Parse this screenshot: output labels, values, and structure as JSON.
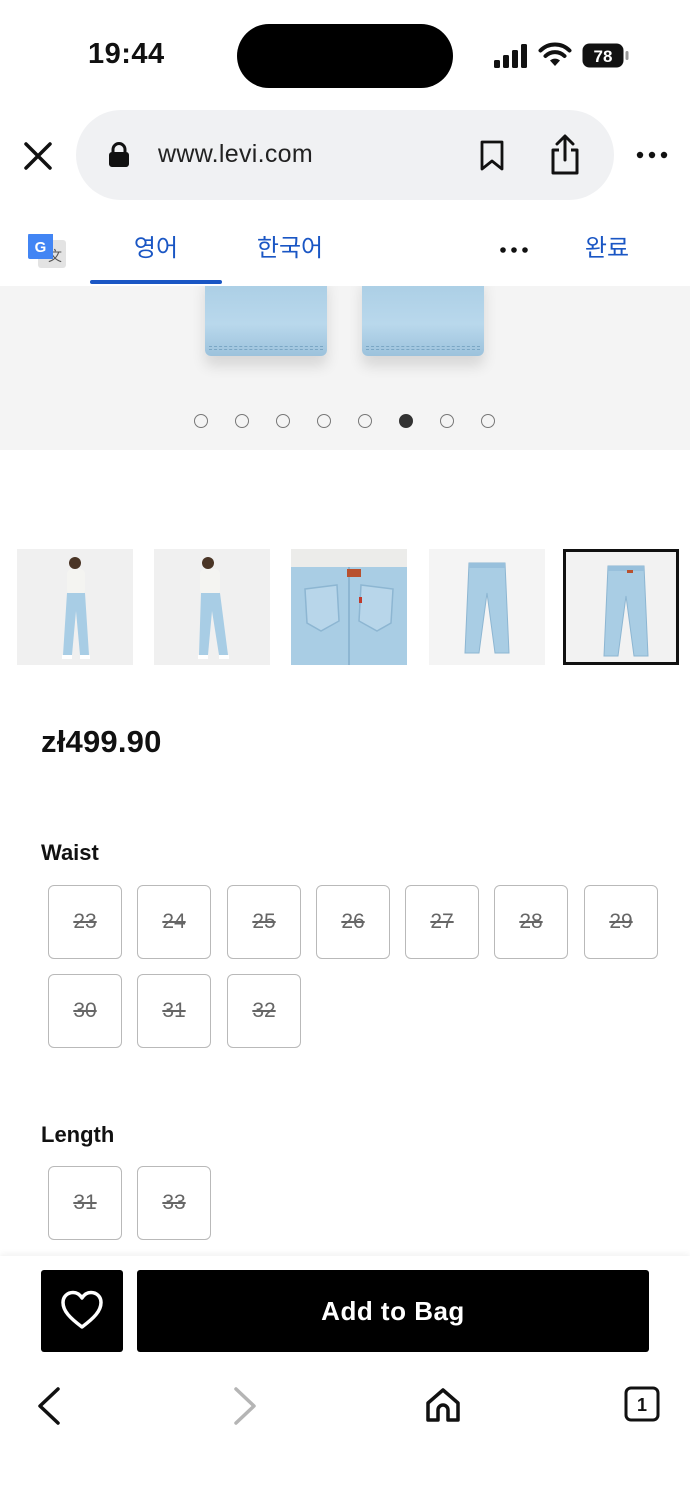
{
  "status_bar": {
    "time": "19:44",
    "battery": "78"
  },
  "browser": {
    "url": "www.levi.com"
  },
  "translate_bar": {
    "tab_source": "영어",
    "tab_target": "한국어",
    "done_label": "완료",
    "google_glyph": "G",
    "translate_glyph": "文"
  },
  "gallery": {
    "total_images": 8,
    "active_index": 5,
    "thumbnails": [
      "model-front",
      "model-back",
      "back-pocket-closeup",
      "jeans-front",
      "jeans-back"
    ],
    "selected_thumbnail": 4
  },
  "product": {
    "price": "zł499.90"
  },
  "waist": {
    "label": "Waist",
    "sizes": [
      "23",
      "24",
      "25",
      "26",
      "27",
      "28",
      "29",
      "30",
      "31",
      "32"
    ],
    "unavailable": true
  },
  "length": {
    "label": "Length",
    "sizes": [
      "31",
      "33"
    ],
    "unavailable": true
  },
  "actions": {
    "wishlist_icon": "heart-icon",
    "add_to_bag": "Add to Bag"
  },
  "bottom_nav": {
    "tab_count": "1"
  },
  "colors": {
    "translate_blue": "#1a56c4",
    "denim": "#a9cde4",
    "primary_button": "#000000"
  }
}
